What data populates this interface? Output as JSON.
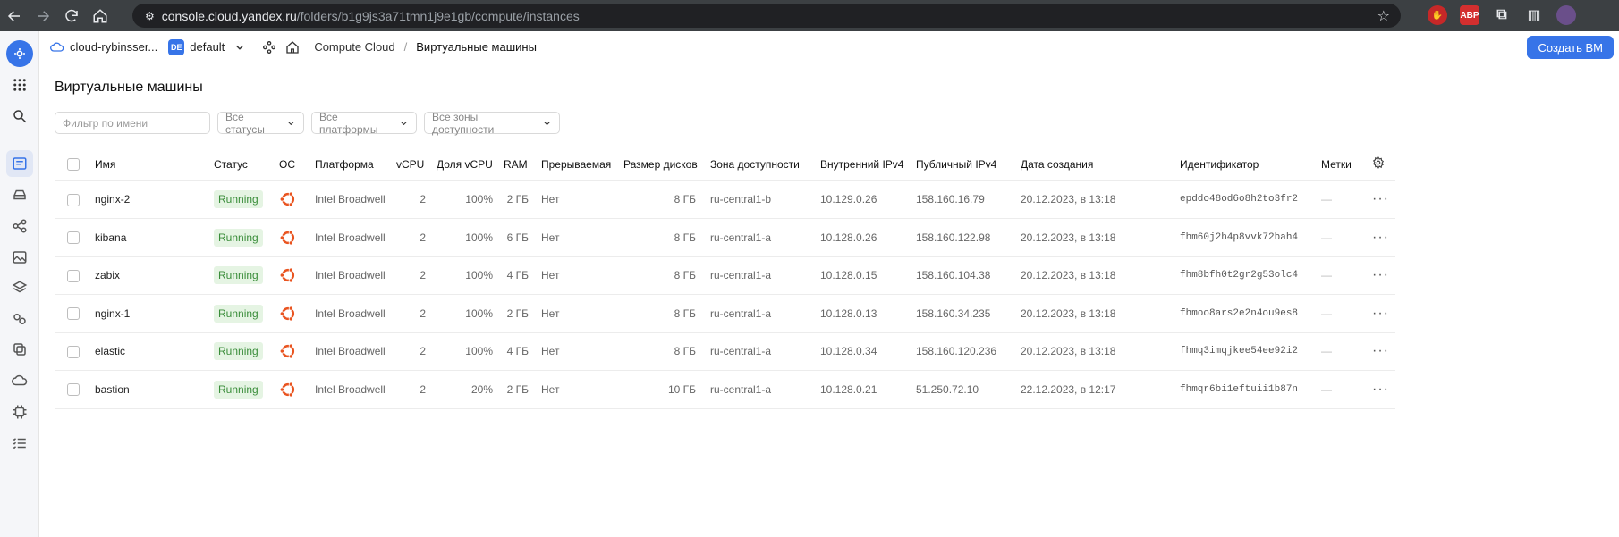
{
  "browser": {
    "url_host": "console.cloud.yandex.ru",
    "url_path": "/folders/b1g9js3a71tmn1j9e1gb/compute/instances"
  },
  "header": {
    "cloud": "cloud-rybinsser...",
    "folder_badge": "DE",
    "folder": "default",
    "crumb_service": "Compute Cloud",
    "crumb_current": "Виртуальные машины",
    "create_button": "Создать ВМ"
  },
  "page": {
    "title": "Виртуальные машины",
    "filter_placeholder": "Фильтр по имени",
    "filter_status": "Все статусы",
    "filter_platform": "Все платформы",
    "filter_zone": "Все зоны доступности"
  },
  "table": {
    "columns": [
      "Имя",
      "Статус",
      "ОС",
      "Платформа",
      "vCPU",
      "Доля vCPU",
      "RAM",
      "Прерываемая",
      "Размер дисков",
      "Зона доступности",
      "Внутренний IPv4",
      "Публичный IPv4",
      "Дата создания",
      "Идентификатор",
      "Метки"
    ],
    "rows": [
      {
        "name": "nginx-2",
        "status": "Running",
        "platform": "Intel Broadwell",
        "vcpu": "2",
        "share": "100%",
        "ram": "2 ГБ",
        "preempt": "Нет",
        "disk": "8 ГБ",
        "zone": "ru-central1-b",
        "int_ip": "10.129.0.26",
        "pub_ip": "158.160.16.79",
        "created": "20.12.2023, в 13:18",
        "id": "epddo48od6o8h2to3fr2",
        "labels": "—"
      },
      {
        "name": "kibana",
        "status": "Running",
        "platform": "Intel Broadwell",
        "vcpu": "2",
        "share": "100%",
        "ram": "6 ГБ",
        "preempt": "Нет",
        "disk": "8 ГБ",
        "zone": "ru-central1-a",
        "int_ip": "10.128.0.26",
        "pub_ip": "158.160.122.98",
        "created": "20.12.2023, в 13:18",
        "id": "fhm60j2h4p8vvk72bah4",
        "labels": "—"
      },
      {
        "name": "zabix",
        "status": "Running",
        "platform": "Intel Broadwell",
        "vcpu": "2",
        "share": "100%",
        "ram": "4 ГБ",
        "preempt": "Нет",
        "disk": "8 ГБ",
        "zone": "ru-central1-a",
        "int_ip": "10.128.0.15",
        "pub_ip": "158.160.104.38",
        "created": "20.12.2023, в 13:18",
        "id": "fhm8bfh0t2gr2g53olc4",
        "labels": "—"
      },
      {
        "name": "nginx-1",
        "status": "Running",
        "platform": "Intel Broadwell",
        "vcpu": "2",
        "share": "100%",
        "ram": "2 ГБ",
        "preempt": "Нет",
        "disk": "8 ГБ",
        "zone": "ru-central1-a",
        "int_ip": "10.128.0.13",
        "pub_ip": "158.160.34.235",
        "created": "20.12.2023, в 13:18",
        "id": "fhmoo8ars2e2n4ou9es8",
        "labels": "—"
      },
      {
        "name": "elastic",
        "status": "Running",
        "platform": "Intel Broadwell",
        "vcpu": "2",
        "share": "100%",
        "ram": "4 ГБ",
        "preempt": "Нет",
        "disk": "8 ГБ",
        "zone": "ru-central1-a",
        "int_ip": "10.128.0.34",
        "pub_ip": "158.160.120.236",
        "created": "20.12.2023, в 13:18",
        "id": "fhmq3imqjkee54ee92i2",
        "labels": "—"
      },
      {
        "name": "bastion",
        "status": "Running",
        "platform": "Intel Broadwell",
        "vcpu": "2",
        "share": "20%",
        "ram": "2 ГБ",
        "preempt": "Нет",
        "disk": "10 ГБ",
        "zone": "ru-central1-a",
        "int_ip": "10.128.0.21",
        "pub_ip": "51.250.72.10",
        "created": "22.12.2023, в 12:17",
        "id": "fhmqr6bi1eftuii1b87n",
        "labels": "—"
      }
    ]
  },
  "colors": {
    "accent": "#3774e8",
    "status_bg": "#e5f4e3",
    "status_fg": "#3a8d3a",
    "ubuntu": "#e95420"
  }
}
